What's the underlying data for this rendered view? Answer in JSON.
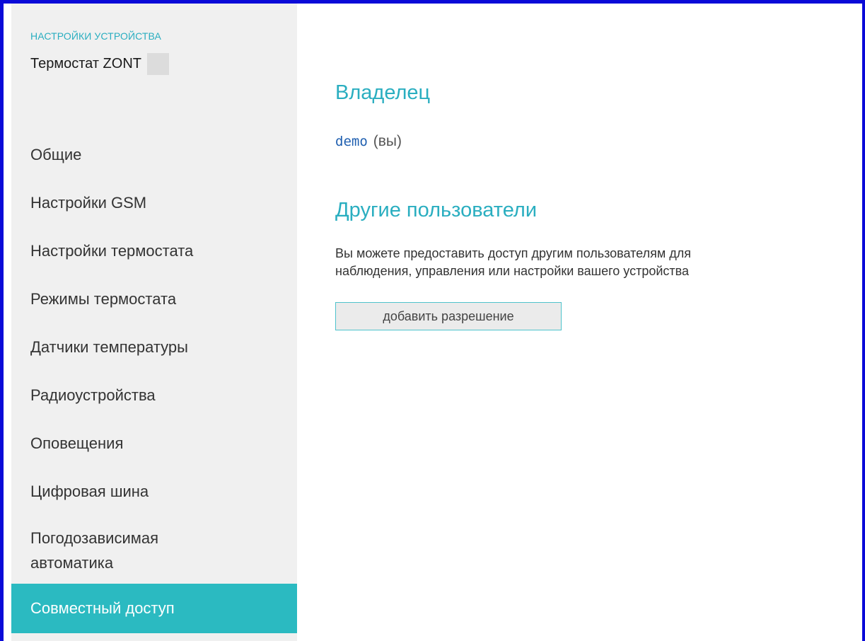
{
  "sidebar": {
    "section_label": "НАСТРОЙКИ УСТРОЙСТВА",
    "device_name": "Термостат ZONT",
    "items": [
      {
        "label": "Общие"
      },
      {
        "label": "Настройки GSM"
      },
      {
        "label": "Настройки термостата"
      },
      {
        "label": "Режимы термостата"
      },
      {
        "label": "Датчики температуры"
      },
      {
        "label": "Радиоустройства"
      },
      {
        "label": "Оповещения"
      },
      {
        "label": "Цифровая шина"
      },
      {
        "label": "Погодозависимая автоматика"
      },
      {
        "label": "Совместный доступ",
        "active": true
      }
    ]
  },
  "main": {
    "owner_heading": "Владелец",
    "owner_name": "demo",
    "owner_suffix": "(вы)",
    "others_heading": "Другие пользователи",
    "others_description_line1": "Вы можете предоставить доступ другим пользователям для",
    "others_description_line2": "наблюдения, управления или настройки вашего устройства",
    "add_permission_label": "добавить разрешение"
  },
  "colors": {
    "frame_border": "#0a0ad8",
    "accent": "#2aaec0",
    "active_item_bg": "#2bbac1",
    "sidebar_bg": "#f0f0f0",
    "link": "#1f5fb0"
  }
}
